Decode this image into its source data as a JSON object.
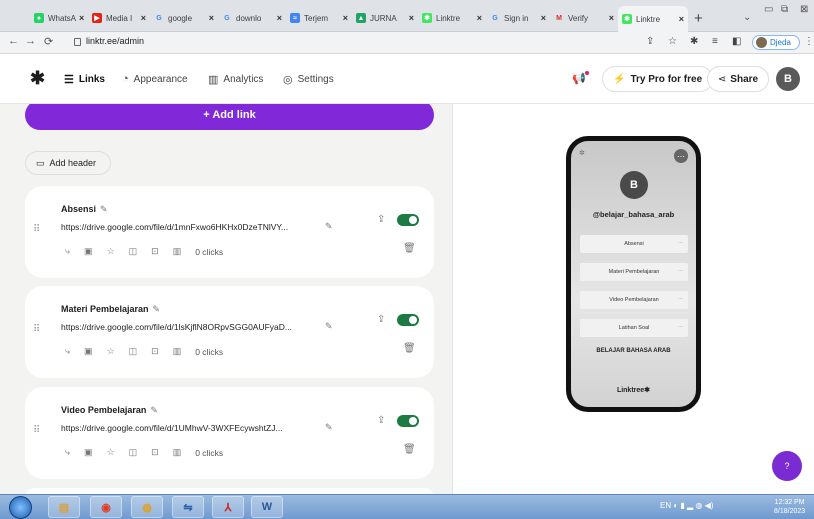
{
  "browser": {
    "tabs": [
      {
        "label": "WhatsA",
        "icon": "whatsapp-icon",
        "color": "#25d366"
      },
      {
        "label": "Media I",
        "icon": "youtube-icon",
        "color": "#e62117"
      },
      {
        "label": "google",
        "icon": "google-icon",
        "color": "#4285f4"
      },
      {
        "label": "downlo",
        "icon": "google-icon",
        "color": "#4285f4"
      },
      {
        "label": "Terjem",
        "icon": "translate-icon",
        "color": "#4285f4"
      },
      {
        "label": "JURNA",
        "icon": "drive-icon",
        "color": "#1fa463"
      },
      {
        "label": "Linktre",
        "icon": "linktree-icon",
        "color": "#43e660"
      },
      {
        "label": "Sign in",
        "icon": "google-icon",
        "color": "#4285f4"
      },
      {
        "label": "Verify",
        "icon": "gmail-icon",
        "color": "#d93025"
      },
      {
        "label": "Linktre",
        "icon": "linktree-icon",
        "color": "#43e660"
      }
    ],
    "url": "linktr.ee/admin",
    "profile_name": "Djeda"
  },
  "header": {
    "logo": "✱",
    "nav": [
      {
        "label": "Links",
        "icon": "links-icon"
      },
      {
        "label": "Appearance",
        "icon": "appearance-icon"
      },
      {
        "label": "Analytics",
        "icon": "analytics-icon"
      },
      {
        "label": "Settings",
        "icon": "settings-icon"
      }
    ],
    "try_pro": "Try Pro for free",
    "share": "Share",
    "avatar_letter": "B"
  },
  "editor": {
    "add_link": "+ Add link",
    "add_header": "Add header",
    "links": [
      {
        "title": "Absensi",
        "url": "https://drive.google.com/file/d/1mnFxwo6HKHx0DzeTNlVY...",
        "clicks": "0 clicks",
        "enabled": true
      },
      {
        "title": "Materi Pembelajaran",
        "url": "https://drive.google.com/file/d/1lsKjflN8ORpvSGG0AUFyaD...",
        "clicks": "0 clicks",
        "enabled": true
      },
      {
        "title": "Video Pembelajaran",
        "url": "https://drive.google.com/file/d/1UMhwV-3WXFEcywshtZJ...",
        "clicks": "0 clicks",
        "enabled": true
      }
    ]
  },
  "preview": {
    "avatar_letter": "B",
    "handle": "@belajar_bahasa_arab",
    "buttons": [
      "Absensi",
      "Materi Pembelajaran",
      "Video Pembelajaran",
      "Latihan Soal"
    ],
    "bottom_title": "BELAJAR BAHASA ARAB",
    "footer": "Linktree✱"
  },
  "help": "?",
  "taskbar": {
    "apps": [
      "explorer",
      "media",
      "chrome",
      "network",
      "acrobat",
      "word"
    ],
    "lang": "EN",
    "time": "12:32 PM",
    "date": "8/18/2023"
  },
  "colors": {
    "accent": "#8129d9",
    "toggle": "#1d7a43"
  }
}
